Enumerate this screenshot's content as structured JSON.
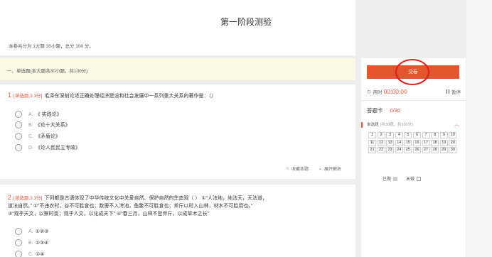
{
  "header": {
    "title": "第一阶段测验",
    "summary": "本卷共分为 1大题 30小题，总分 100 分。"
  },
  "section": {
    "label": "一、单选题(本大题共30小题，共100分)"
  },
  "questions": [
    {
      "number": "1",
      "type": "[单选题,3.3分]",
      "lines": [
        "毛泽东深刻论述正确处理经济建设和社会发展中一系列重大关系的著作是：（）"
      ],
      "options": [
        {
          "letter": "A.",
          "text": "《 实践论》"
        },
        {
          "letter": "B.",
          "text": "《论十大关系》"
        },
        {
          "letter": "C.",
          "text": "《矛盾论》"
        },
        {
          "letter": "D.",
          "text": "《论人民民主专政》"
        }
      ],
      "actions": {
        "favorite": "收藏本题",
        "expand": "展开解析"
      }
    },
    {
      "number": "2",
      "type": "[单选题,3.3分]",
      "lines": [
        "下列都是古语体现了中华传统文化中关爱自然、保护自然的生态观（ ） ①“人法地，地法天，天法道，",
        "道法自然。” ②“不违农时，谷不可胜食也；数罟不入洿池，鱼鳖不可胜食也；斧斤以时入山林，材木不可胜用也。”",
        "③“观乎天文，以察时变；观乎人文，以化成天下” ④“春三月，山林不登斧斤，以成草木之长”"
      ],
      "options": [
        {
          "letter": "A.",
          "text": "①②③"
        },
        {
          "letter": "B.",
          "text": "②③④"
        },
        {
          "letter": "C.",
          "text": "①④"
        }
      ]
    }
  ],
  "sidebar": {
    "submit_label": "交卷",
    "timer_label": "用时",
    "timer_value": "00:00:00",
    "pause_label": "暂停",
    "card_label": "答题卡",
    "card_count": "0/30",
    "card_section": "单选题",
    "card_section_detail": "(共30题，共100分)",
    "cells": [
      "1",
      "2",
      "3",
      "4",
      "5",
      "6",
      "7",
      "8",
      "9",
      "10",
      "11",
      "12",
      "13",
      "14",
      "15",
      "16",
      "17",
      "18",
      "19",
      "20",
      "21",
      "22",
      "23",
      "24",
      "25",
      "26",
      "27",
      "28",
      "29",
      "30"
    ],
    "legend_done": "已做",
    "legend_undone": "未做"
  },
  "colors": {
    "accent": "#e4572e",
    "highlight_circle": "#e01d1d",
    "section_bg": "#fdf7e6"
  }
}
